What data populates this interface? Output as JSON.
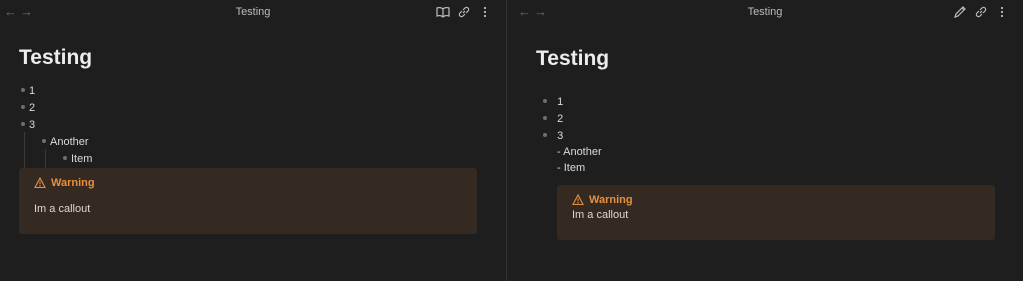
{
  "left": {
    "title": "Testing",
    "heading": "Testing",
    "items": [
      "1",
      "2",
      "3"
    ],
    "nested": [
      "Another"
    ],
    "nested2": [
      "Item"
    ],
    "callout": {
      "type": "Warning",
      "text": "Im a callout"
    },
    "actions": [
      "book-icon",
      "link-icon",
      "more-icon"
    ]
  },
  "right": {
    "title": "Testing",
    "heading": "Testing",
    "items": [
      "1",
      "2",
      "3"
    ],
    "lines": [
      "- Another",
      "- Item"
    ],
    "callout": {
      "type": "Warning",
      "text": "Im a callout"
    },
    "actions": [
      "edit-icon",
      "link-icon",
      "more-icon"
    ]
  },
  "colors": {
    "bg": "#1e1e1e",
    "callout": "#352a21",
    "warning": "#e6903f"
  }
}
